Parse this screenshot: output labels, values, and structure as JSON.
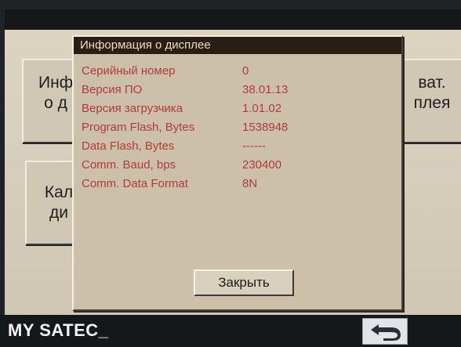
{
  "menu": {
    "info_button": {
      "line1": "Инф",
      "line2": "о д"
    },
    "calib_button": {
      "line1": "Кал",
      "line2": "ди"
    },
    "right_button": {
      "line1": "ват.",
      "line2": "плея"
    }
  },
  "dialog": {
    "title": "Информация о дисплее",
    "rows": [
      {
        "label": "Серийный номер",
        "value": "0"
      },
      {
        "label": "Версия ПО",
        "value": "38.01.13"
      },
      {
        "label": "Версия загрузчика",
        "value": "1.01.02"
      },
      {
        "label": "Program Flash, Bytes",
        "value": "1538948"
      },
      {
        "label": "Data Flash, Bytes",
        "value": "------"
      },
      {
        "label": "Comm. Baud, bps",
        "value": "230400"
      },
      {
        "label": "Comm. Data Format",
        "value": "8N"
      }
    ],
    "close_label": "Закрыть"
  },
  "status_bar": {
    "text": "MY SATEC_",
    "back_icon": "back-arrow-icon"
  },
  "colors": {
    "screen_bg": "#d8d0be",
    "dialog_bg": "#ccc0a8",
    "title_bar": "#2a1d14",
    "row_text": "#b23a3e",
    "status_bar": "#15181b"
  }
}
